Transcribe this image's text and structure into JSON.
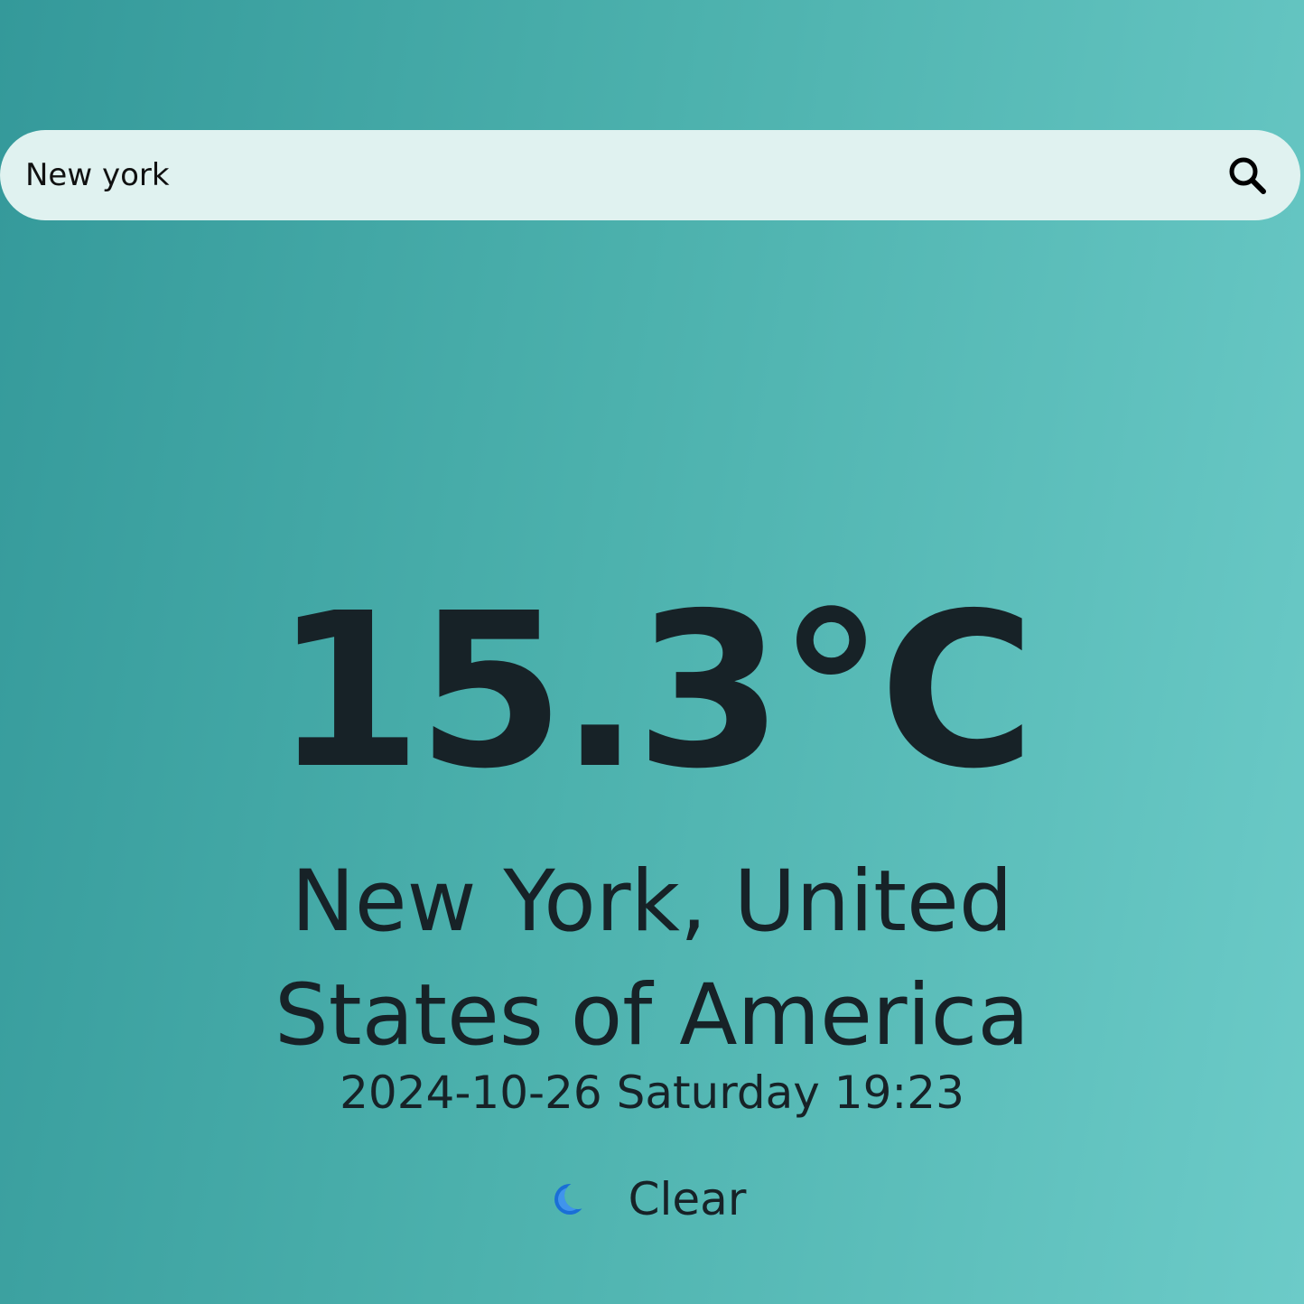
{
  "search": {
    "value": "New york",
    "icon": "search-icon"
  },
  "weather": {
    "temperature": "15.3°C",
    "location": "New York, United States of America",
    "datetime": "2024-10-26 Saturday 19:23",
    "condition": "Clear",
    "condition_icon": "moon-icon"
  },
  "colors": {
    "background_start": "#34999a",
    "background_end": "#6ccbc8",
    "search_bar": "#e0f2f0",
    "text": "#172227",
    "moon": "#1a6fd6"
  }
}
